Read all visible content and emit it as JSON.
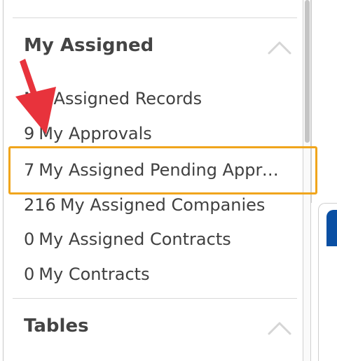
{
  "sidebar": {
    "sections": [
      {
        "title": "My Assigned",
        "items": [
          {
            "count": "",
            "label": "My Assigned Records"
          },
          {
            "count": "9",
            "label": "My Approvals"
          },
          {
            "count": "7",
            "label": "My Assigned Pending Approvals"
          },
          {
            "count": "216",
            "label": "My Assigned Companies"
          },
          {
            "count": "0",
            "label": "My Assigned Contracts"
          },
          {
            "count": "0",
            "label": "My Contracts"
          }
        ]
      },
      {
        "title": "Tables",
        "items": []
      }
    ]
  },
  "colors": {
    "highlight": "#f0a51c",
    "arrow": "#e8333c",
    "accent": "#0a4fa3"
  },
  "icons": {
    "collapse": "chevron-up-icon",
    "annotation": "arrow-icon"
  }
}
